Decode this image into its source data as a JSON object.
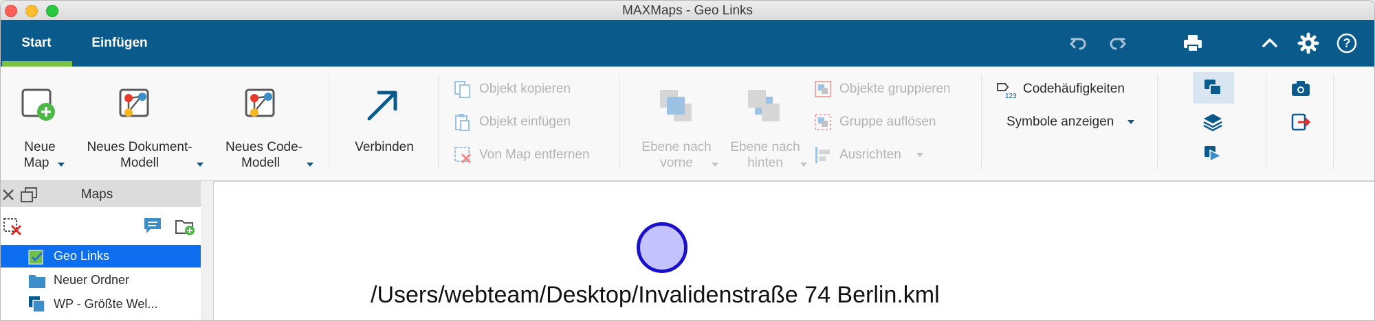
{
  "window": {
    "title": "MAXMaps - Geo Links"
  },
  "tabs": [
    {
      "label": "Start",
      "active": true
    },
    {
      "label": "Einfügen",
      "active": false
    }
  ],
  "toolbar_icons": [
    "undo-icon",
    "redo-icon",
    "print-icon",
    "collapse-ribbon-icon",
    "settings-icon",
    "help-icon"
  ],
  "ribbon": {
    "neue_map": [
      "Neue",
      "Map"
    ],
    "neues_dokument_modell": [
      "Neues Dokument-",
      "Modell"
    ],
    "neues_code_modell": [
      "Neues Code-",
      "Modell"
    ],
    "verbinden": "Verbinden",
    "objekt_kopieren": "Objekt kopieren",
    "objekt_einfuegen": "Objekt einfügen",
    "von_map_entfernen": "Von Map entfernen",
    "ebene_nach_vorne": [
      "Ebene nach",
      "vorne"
    ],
    "ebene_nach_hinten": [
      "Ebene nach",
      "hinten"
    ],
    "objekte_gruppieren": "Objekte gruppieren",
    "gruppe_aufloesen": "Gruppe auflösen",
    "ausrichten": "Ausrichten",
    "codehaeufigkeiten": "Codehäufigkeiten",
    "symbole_anzeigen": "Symbole anzeigen"
  },
  "panel": {
    "title": "Maps",
    "items": [
      {
        "label": "Geo Links",
        "selected": true,
        "icon": "map-icon"
      },
      {
        "label": "Neuer Ordner",
        "selected": false,
        "icon": "folder-icon"
      },
      {
        "label": "WP - Größte Wel...",
        "selected": false,
        "icon": "map-stack-icon"
      }
    ]
  },
  "canvas": {
    "node_label": "/Users/webteam/Desktop/Invalidenstraße 74 Berlin.kml"
  },
  "colors": {
    "ribbon_blue": "#0b5a8c",
    "active_tab_underline": "#7ac142",
    "selection_blue": "#0d6ff0",
    "node_fill": "#c4c2ff",
    "node_border": "#1a10c9"
  }
}
